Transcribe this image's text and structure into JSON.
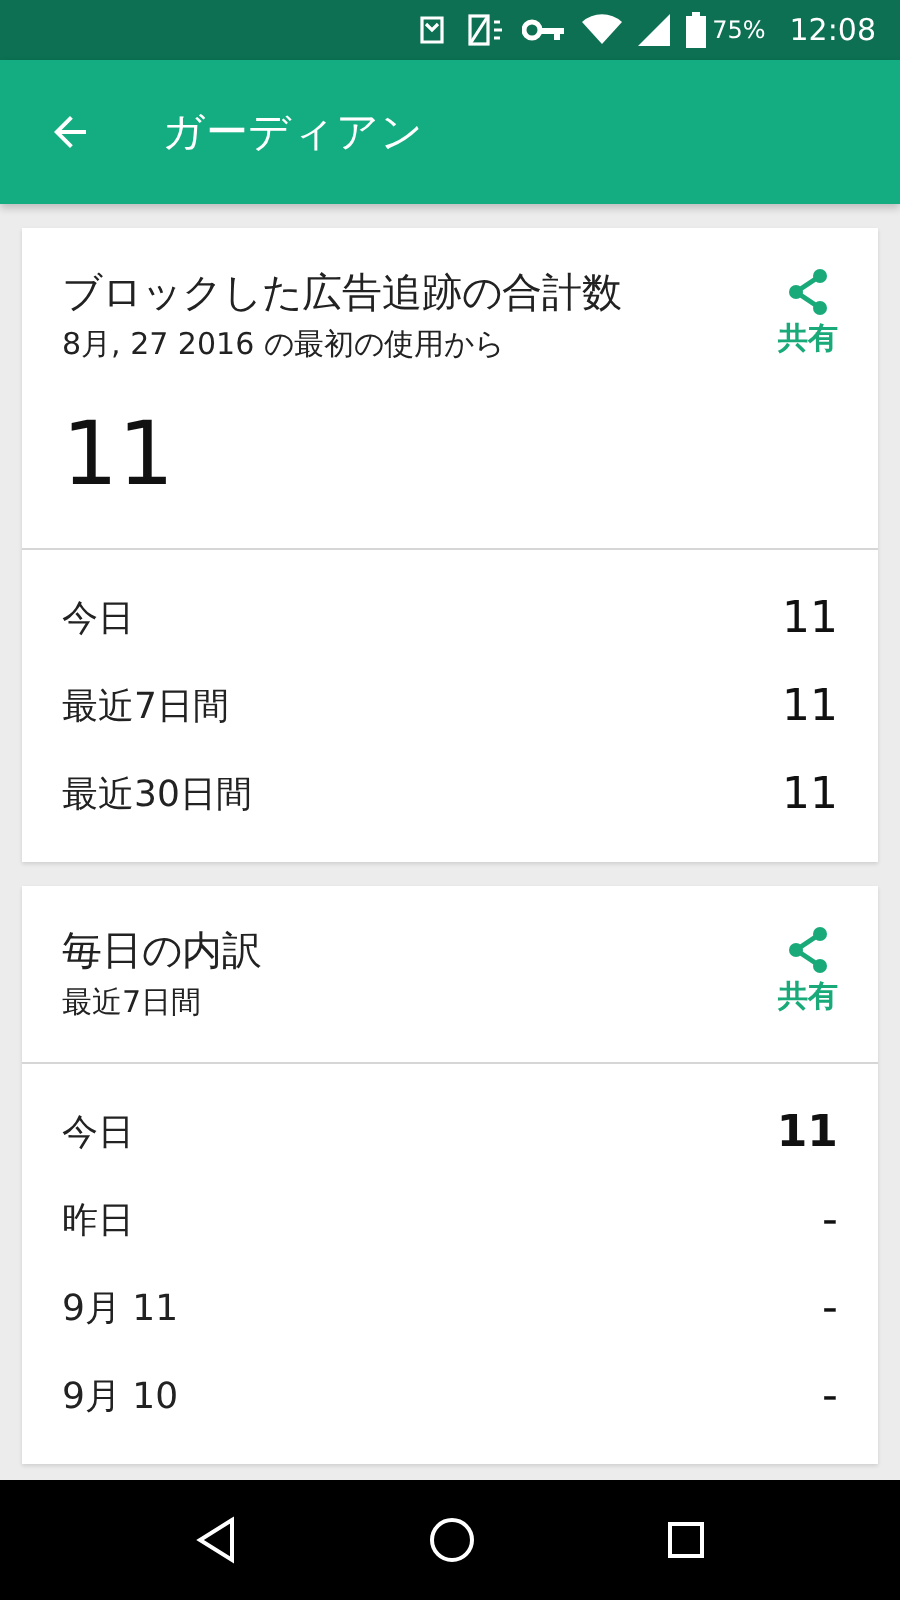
{
  "status_bar": {
    "battery": "75%",
    "time": "12:08"
  },
  "app_bar": {
    "title": "ガーディアン"
  },
  "total_card": {
    "title": "ブロックした広告追跡の合計数",
    "subtitle": "8月, 27 2016 の最初の使用から",
    "total": "11",
    "share_label": "共有",
    "rows": [
      {
        "label": "今日",
        "value": "11"
      },
      {
        "label": "最近7日間",
        "value": "11"
      },
      {
        "label": "最近30日間",
        "value": "11"
      }
    ]
  },
  "daily_card": {
    "title": "毎日の内訳",
    "subtitle": "最近7日間",
    "share_label": "共有",
    "rows": [
      {
        "label": "今日",
        "value": "11",
        "bold": true
      },
      {
        "label": "昨日",
        "value": "-",
        "bold": false
      },
      {
        "label": "9月 11",
        "value": "-",
        "bold": false
      },
      {
        "label": "9月 10",
        "value": "-",
        "bold": false
      }
    ]
  }
}
